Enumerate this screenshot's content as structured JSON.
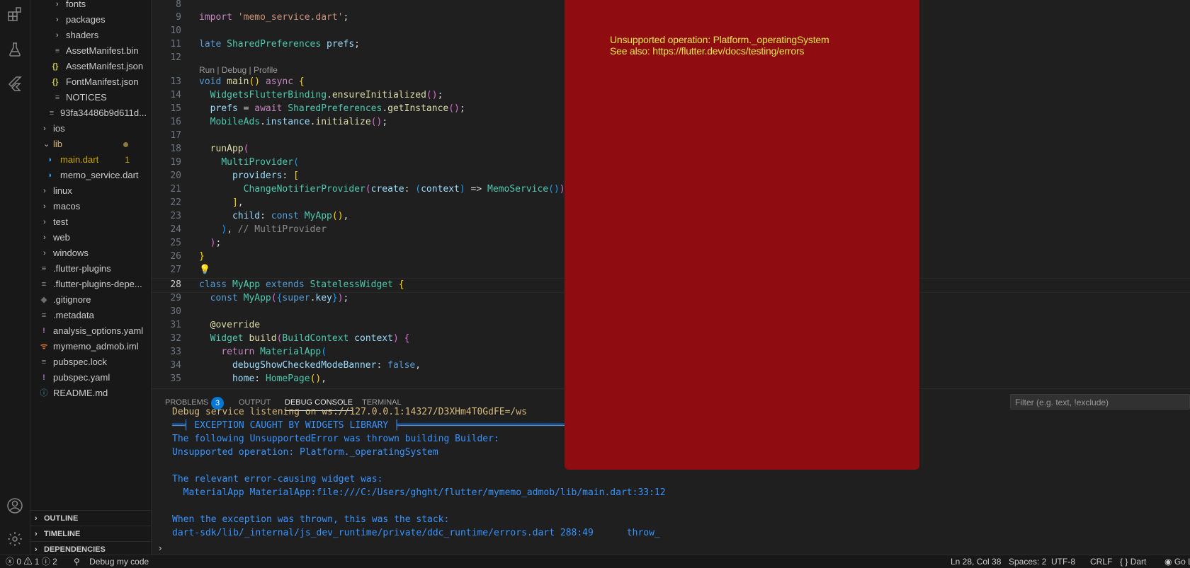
{
  "explorer": {
    "items": [
      {
        "label": "fonts",
        "kind": "folder"
      },
      {
        "label": "packages",
        "kind": "folder"
      },
      {
        "label": "shaders",
        "kind": "folder"
      },
      {
        "label": "AssetManifest.bin",
        "kind": "file"
      },
      {
        "label": "AssetManifest.json",
        "kind": "json",
        "icon": "{}"
      },
      {
        "label": "FontManifest.json",
        "kind": "json",
        "icon": "{}"
      },
      {
        "label": "NOTICES",
        "kind": "file"
      },
      {
        "label": "93fa34486b9d611d...",
        "kind": "file"
      },
      {
        "label": "ios",
        "kind": "folder"
      },
      {
        "label": "lib",
        "kind": "folder-open"
      },
      {
        "label": "main.dart",
        "kind": "dart",
        "badge": "1"
      },
      {
        "label": "memo_service.dart",
        "kind": "dart"
      },
      {
        "label": "linux",
        "kind": "folder"
      },
      {
        "label": "macos",
        "kind": "folder"
      },
      {
        "label": "test",
        "kind": "folder"
      },
      {
        "label": "web",
        "kind": "folder"
      },
      {
        "label": "windows",
        "kind": "folder"
      },
      {
        "label": ".flutter-plugins",
        "kind": "file"
      },
      {
        "label": ".flutter-plugins-depe...",
        "kind": "file"
      },
      {
        "label": ".gitignore",
        "kind": "git"
      },
      {
        "label": ".metadata",
        "kind": "file"
      },
      {
        "label": "analysis_options.yaml",
        "kind": "yaml",
        "icon": "!"
      },
      {
        "label": "mymemo_admob.iml",
        "kind": "rss"
      },
      {
        "label": "pubspec.lock",
        "kind": "file"
      },
      {
        "label": "pubspec.yaml",
        "kind": "yaml",
        "icon": "!"
      },
      {
        "label": "README.md",
        "kind": "info",
        "icon": "ⓘ"
      }
    ],
    "sections": [
      "OUTLINE",
      "TIMELINE",
      "DEPENDENCIES"
    ]
  },
  "editor": {
    "line_numbers": [
      "8",
      "9",
      "10",
      "11",
      "12",
      "13",
      "14",
      "15",
      "16",
      "17",
      "18",
      "19",
      "20",
      "21",
      "22",
      "23",
      "24",
      "25",
      "26",
      "27",
      "28",
      "29",
      "30",
      "31",
      "32",
      "33",
      "34",
      "35"
    ],
    "active_line": "28",
    "codelens": "Run | Debug | Profile"
  },
  "panel": {
    "tabs": [
      "PROBLEMS",
      "OUTPUT",
      "DEBUG CONSOLE",
      "TERMINAL"
    ],
    "active_tab": "DEBUG CONSOLE",
    "problems_count": "3",
    "filter_placeholder": "Filter (e.g. text, !exclude)",
    "console_lines": [
      "Debug service listening on ws://127.0.0.1:14327/D3XHm4T0GdFE=/ws",
      "══╡ EXCEPTION CAUGHT BY WIDGETS LIBRARY ╞═════════════════════════════════════════",
      "The following UnsupportedError was thrown building Builder:",
      "Unsupported operation: Platform._operatingSystem",
      "",
      "The relevant error-causing widget was:",
      "  MaterialApp MaterialApp:file:///C:/Users/ghght/flutter/mymemo_admob/lib/main.dart:33:12",
      "",
      "When the exception was thrown, this was the stack:",
      "dart-sdk/lib/_internal/js_dev_runtime/private/ddc_runtime/errors.dart 288:49      throw_"
    ]
  },
  "overlay": {
    "line1": "Unsupported operation: Platform._operatingSystem",
    "line2": "See also: https://flutter.dev/docs/testing/errors"
  },
  "status": {
    "errors": "0",
    "warnings": "1",
    "infos": "2",
    "debug_label": "Debug my code",
    "position": "Ln 28, Col 38",
    "spaces": "Spaces: 2",
    "encoding": "UTF-8",
    "eol": "CRLF",
    "language": "Dart",
    "golive": "Go Li"
  },
  "colors": {
    "overlay_bg": "#8f0d10",
    "overlay_text": "#e8e64f",
    "accent": "#0078d4"
  }
}
